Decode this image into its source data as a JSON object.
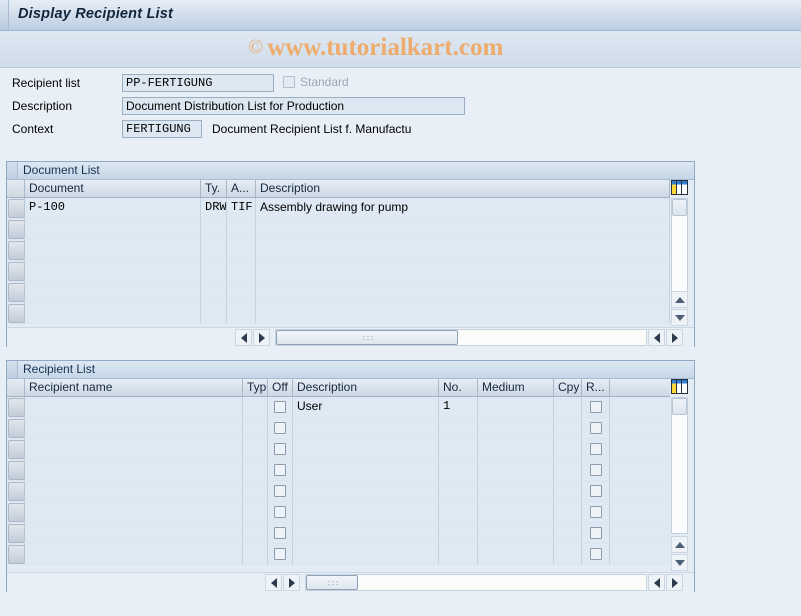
{
  "window": {
    "title": "Display Recipient List"
  },
  "watermark": {
    "symbol": "©",
    "text": "www.tutorialkart.com"
  },
  "form": {
    "recipient_list": {
      "label": "Recipient list",
      "value": "PP-FERTIGUNG",
      "placeholder": ""
    },
    "standard": {
      "label": "Standard",
      "checked": false,
      "enabled": false
    },
    "description": {
      "label": "Description",
      "value": "Document Distribution List for Production",
      "placeholder": ""
    },
    "context": {
      "label": "Context",
      "value": "FERTIGUNG",
      "placeholder": "",
      "text": "Document Recipient List f. Manufactu"
    }
  },
  "document_list": {
    "title": "Document List",
    "columns": [
      "Document",
      "Ty.",
      "A...",
      "Description"
    ],
    "rows": [
      {
        "document": "P-100",
        "type": "DRW",
        "app": "TIF",
        "description": "Assembly drawing for pump"
      },
      {
        "document": "",
        "type": "",
        "app": "",
        "description": ""
      },
      {
        "document": "",
        "type": "",
        "app": "",
        "description": ""
      },
      {
        "document": "",
        "type": "",
        "app": "",
        "description": ""
      },
      {
        "document": "",
        "type": "",
        "app": "",
        "description": ""
      },
      {
        "document": "",
        "type": "",
        "app": "",
        "description": ""
      }
    ],
    "config_icon": "table-settings-icon"
  },
  "recipient_list": {
    "title": "Recipient List",
    "columns": [
      "Recipient name",
      "Typ",
      "Off",
      "Description",
      "No.",
      "Medium",
      "Cpy",
      "R..."
    ],
    "rows": [
      {
        "name": "",
        "typ": "",
        "off": false,
        "description": "User",
        "no": "1",
        "medium": "",
        "cpy": "",
        "r": false
      },
      {
        "name": "",
        "typ": "",
        "off": false,
        "description": "",
        "no": "",
        "medium": "",
        "cpy": "",
        "r": false
      },
      {
        "name": "",
        "typ": "",
        "off": false,
        "description": "",
        "no": "",
        "medium": "",
        "cpy": "",
        "r": false
      },
      {
        "name": "",
        "typ": "",
        "off": false,
        "description": "",
        "no": "",
        "medium": "",
        "cpy": "",
        "r": false
      },
      {
        "name": "",
        "typ": "",
        "off": false,
        "description": "",
        "no": "",
        "medium": "",
        "cpy": "",
        "r": false
      },
      {
        "name": "",
        "typ": "",
        "off": false,
        "description": "",
        "no": "",
        "medium": "",
        "cpy": "",
        "r": false
      },
      {
        "name": "",
        "typ": "",
        "off": false,
        "description": "",
        "no": "",
        "medium": "",
        "cpy": "",
        "r": false
      },
      {
        "name": "",
        "typ": "",
        "off": false,
        "description": "",
        "no": "",
        "medium": "",
        "cpy": "",
        "r": false
      }
    ],
    "config_icon": "table-settings-icon"
  },
  "colors": {
    "background": "#e9eff6",
    "panel_border": "#8fa9c4",
    "grid_row": "#dfe9f3",
    "title_text": "#11253b",
    "watermark": "#edab6c",
    "icon_yellow": "#ffd83b",
    "icon_blue": "#2f7fd6"
  }
}
